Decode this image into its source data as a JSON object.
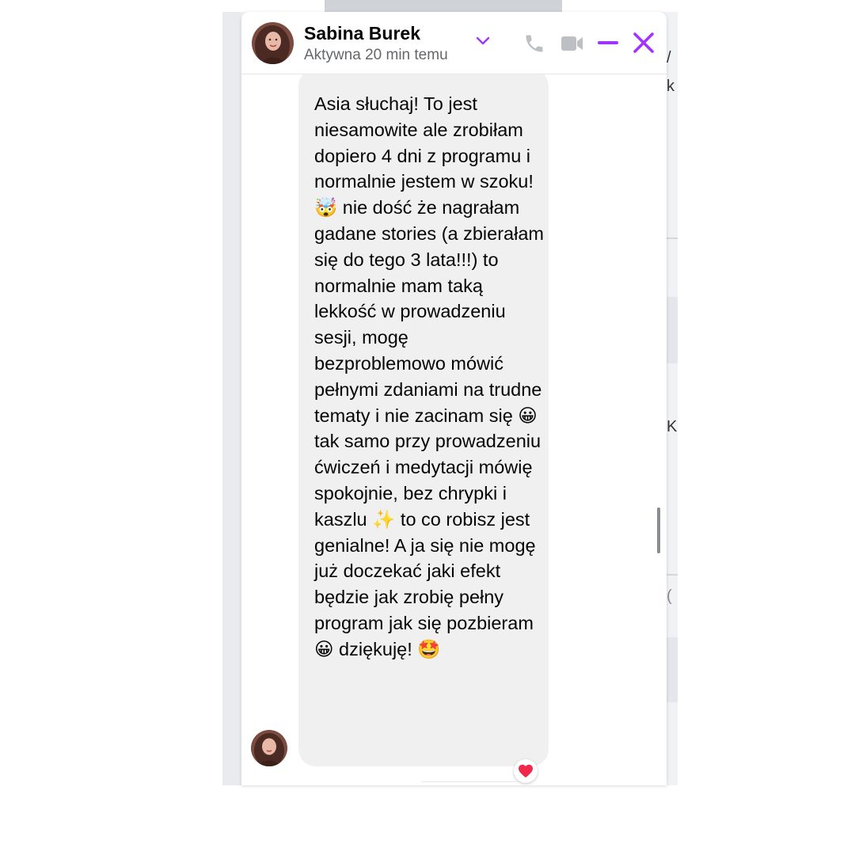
{
  "contact": {
    "name": "Sabina Burek",
    "status": "Aktywna 20 min temu"
  },
  "message": {
    "text": "Asia słuchaj! To jest niesamowite ale zrobiłam dopiero 4 dni z programu i normalnie jestem w szoku! 🤯 nie dość że nagrałam gadane stories (a zbierałam się do tego 3 lata!!!) to normalnie mam taką lekkość w prowadzeniu sesji, mogę bezproblemowo mówić pełnymi zdaniami na trudne tematy i nie zacinam się 😀 tak samo przy prowadzeniu ćwiczeń i medytacji mówię spokojnie, bez chrypki i kaszlu ✨ to co robisz jest genialne! A ja się nie mogę już doczekać jaki efekt będzie jak zrobię pełny program jak się pozbieram 😀 dziękuję! 🤩",
    "reaction": "heart"
  },
  "icons": {
    "chevron": "chevron-down-icon",
    "phone": "phone-icon",
    "video": "video-camera-icon",
    "minimize": "minimize-icon",
    "close": "close-icon"
  },
  "background_fragments": [
    "/",
    "k",
    "K",
    "("
  ],
  "colors": {
    "accent": "#a033ff",
    "header_icon_gray": "#bcc0c4",
    "bubble": "#f0f0f0",
    "reaction": "#f02849"
  }
}
